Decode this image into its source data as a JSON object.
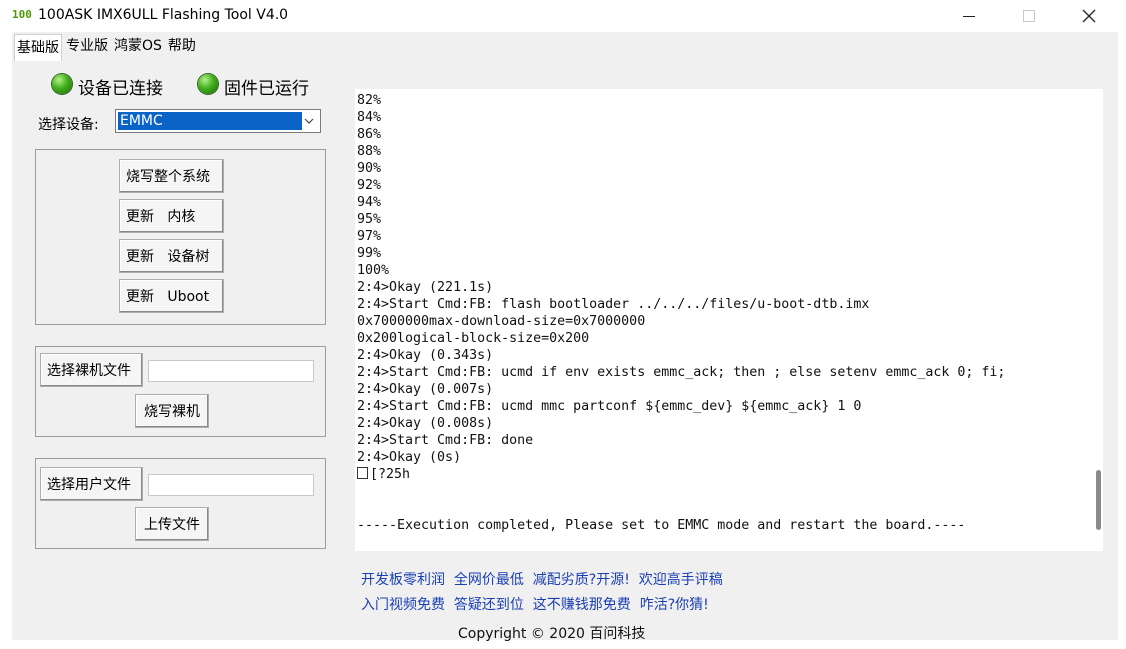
{
  "window": {
    "logo_text": "100",
    "title": "100ASK IMX6ULL Flashing Tool V4.0"
  },
  "menu": [
    "基础版",
    "专业版",
    "鸿蒙OS",
    "帮助"
  ],
  "status": {
    "connected_label": "设备已连接",
    "firmware_label": "固件已运行",
    "led_color": "#3fae1c"
  },
  "device": {
    "label": "选择设备:",
    "selected": "EMMC"
  },
  "flash_group": {
    "buttons": [
      "烧写整个系统",
      "更新   内核",
      "更新   设备树",
      "更新   Uboot"
    ]
  },
  "bare_group": {
    "select_label": "选择裸机文件",
    "file_value": "",
    "action_label": "烧写裸机"
  },
  "user_group": {
    "select_label": "选择用户文件",
    "file_value": "",
    "action_label": "上传文件"
  },
  "log": {
    "lines": [
      "82%",
      "84%",
      "86%",
      "88%",
      "90%",
      "92%",
      "94%",
      "95%",
      "97%",
      "99%",
      "100%",
      "2:4>Okay (221.1s)",
      "2:4>Start Cmd:FB: flash bootloader ../../../files/u-boot-dtb.imx",
      "0x7000000max-download-size=0x7000000",
      "0x200logical-block-size=0x200",
      "2:4>Okay (0.343s)",
      "2:4>Start Cmd:FB: ucmd if env exists emmc_ack; then ; else setenv emmc_ack 0; fi;",
      "2:4>Okay (0.007s)",
      "2:4>Start Cmd:FB: ucmd mmc partconf ${emmc_dev} ${emmc_ack} 1 0",
      "2:4>Okay (0.008s)",
      "2:4>Start Cmd:FB: done",
      "2:4>Okay (0s)"
    ],
    "escape_line": "[?25h",
    "completion": "-----Execution completed, Please set to EMMC mode and restart the board.----"
  },
  "promo": {
    "line1": "开发板零利润  全网价最低  减配劣质?开源!  欢迎高手评稿",
    "line2": "入门视频免费  答疑还到位  这不赚钱那免费  咋活?你猜!"
  },
  "copyright": "Copyright © 2020 百问科技"
}
